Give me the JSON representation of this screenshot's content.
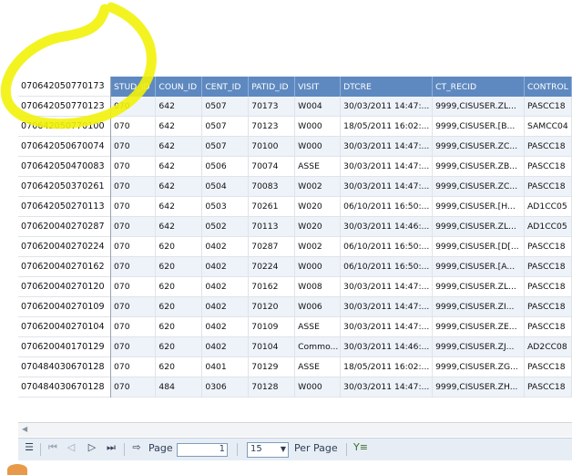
{
  "grid": {
    "columns": [
      "STUD_ID",
      "COUN_ID",
      "CENT_ID",
      "PATID_ID",
      "VISIT",
      "DTCRE",
      "CT_RECID",
      "CONTROL"
    ],
    "ids": [
      "070642050770173",
      "070642050770123",
      "070642050770100",
      "070642050670074",
      "070642050470083",
      "070642050370261",
      "070642050270113",
      "070620040270287",
      "070620040270224",
      "070620040270162",
      "070620040270120",
      "070620040270109",
      "070620040270104",
      "070620040170129",
      "070484030670128",
      "070484030670128"
    ],
    "rows": [
      [
        "070",
        "642",
        "0507",
        "70173",
        "W004",
        "30/03/2011 14:47:...",
        "9999,CISUSER.ZL...",
        "PASCC18"
      ],
      [
        "070",
        "642",
        "0507",
        "70123",
        "W000",
        "18/05/2011 16:02:...",
        "9999,CISUSER.[B...",
        "SAMCC04"
      ],
      [
        "070",
        "642",
        "0507",
        "70100",
        "W000",
        "30/03/2011 14:47:...",
        "9999,CISUSER.ZC...",
        "PASCC18"
      ],
      [
        "070",
        "642",
        "0506",
        "70074",
        "ASSE",
        "30/03/2011 14:47:...",
        "9999,CISUSER.ZB...",
        "PASCC18"
      ],
      [
        "070",
        "642",
        "0504",
        "70083",
        "W002",
        "30/03/2011 14:47:...",
        "9999,CISUSER.ZC...",
        "PASCC18"
      ],
      [
        "070",
        "642",
        "0503",
        "70261",
        "W020",
        "06/10/2011 16:50:...",
        "9999,CISUSER.[H...",
        "AD1CC05"
      ],
      [
        "070",
        "642",
        "0502",
        "70113",
        "W020",
        "30/03/2011 14:46:...",
        "9999,CISUSER.ZL...",
        "AD1CC05"
      ],
      [
        "070",
        "620",
        "0402",
        "70287",
        "W002",
        "06/10/2011 16:50:...",
        "9999,CISUSER.[D[...",
        "PASCC18"
      ],
      [
        "070",
        "620",
        "0402",
        "70224",
        "W000",
        "06/10/2011 16:50:...",
        "9999,CISUSER.[A...",
        "PASCC18"
      ],
      [
        "070",
        "620",
        "0402",
        "70162",
        "W008",
        "30/03/2011 14:47:...",
        "9999,CISUSER.ZL...",
        "PASCC18"
      ],
      [
        "070",
        "620",
        "0402",
        "70120",
        "W006",
        "30/03/2011 14:47:...",
        "9999,CISUSER.ZI...",
        "PASCC18"
      ],
      [
        "070",
        "620",
        "0402",
        "70109",
        "ASSE",
        "30/03/2011 14:47:...",
        "9999,CISUSER.ZE...",
        "PASCC18"
      ],
      [
        "070",
        "620",
        "0402",
        "70104",
        "Commo...",
        "30/03/2011 14:46:...",
        "9999,CISUSER.ZJ...",
        "AD2CC08"
      ],
      [
        "070",
        "620",
        "0401",
        "70129",
        "ASSE",
        "18/05/2011 16:02:...",
        "9999,CISUSER.ZG...",
        "PASCC18"
      ],
      [
        "070",
        "484",
        "0306",
        "70128",
        "W000",
        "30/03/2011 14:47:...",
        "9999,CISUSER.ZH...",
        "PASCC18"
      ]
    ]
  },
  "pager": {
    "page_label": "Page",
    "page_value": "1",
    "per_page_value": "15",
    "per_page_label": "Per Page"
  },
  "colors": {
    "header_bg": "#5e89c0",
    "alt_row": "#eef3fa",
    "highlight": "#f2f20a"
  }
}
